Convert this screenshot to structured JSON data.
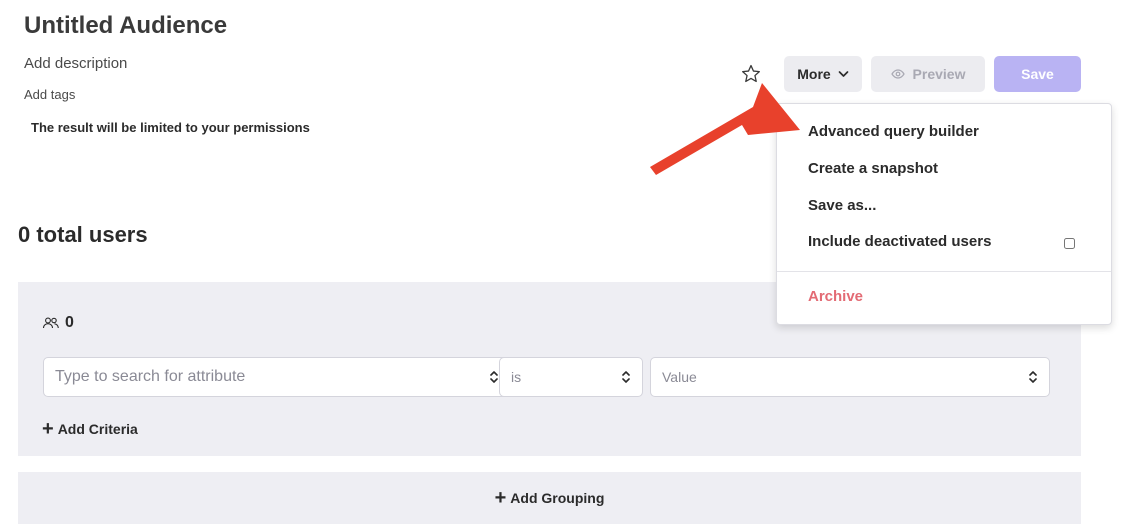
{
  "header": {
    "title": "Untitled Audience",
    "description_placeholder": "Add description",
    "tags_placeholder": "Add tags",
    "permissions_note": "The result will be limited to your permissions"
  },
  "toolbar": {
    "favorite_icon": "star-outline-icon",
    "more_label": "More",
    "preview_label": "Preview",
    "save_label": "Save"
  },
  "more_menu": {
    "items": [
      {
        "label": "Advanced query builder"
      },
      {
        "label": "Create a snapshot"
      },
      {
        "label": "Save as..."
      },
      {
        "label": "Include deactivated users",
        "checked": false
      }
    ],
    "archive_label": "Archive"
  },
  "summary": {
    "total_users": "0 total users"
  },
  "criteria_group": {
    "user_count": "0",
    "attribute_placeholder": "Type to search for attribute",
    "operator_value": "is",
    "value_placeholder": "Value",
    "add_criteria_label": "Add Criteria"
  },
  "add_grouping_label": "Add Grouping",
  "colors": {
    "primary_disabled": "#b9b3f3",
    "danger": "#e36b74",
    "panel_bg": "#eeeef3",
    "annotation": "#e8412c"
  }
}
